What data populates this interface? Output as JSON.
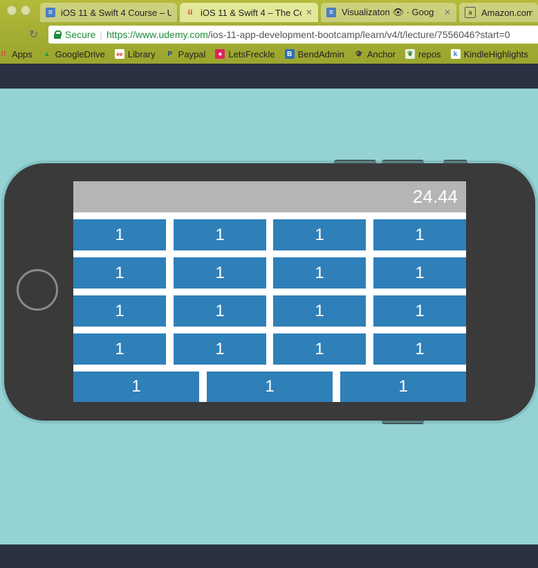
{
  "browser": {
    "tabs": [
      {
        "title": "iOS 11 & Swift 4 Course – U",
        "favicon": "doc-icon"
      },
      {
        "title": "iOS 11 & Swift 4 – The Co",
        "favicon": "udemy-icon"
      },
      {
        "title": "Visualizaton 👁 · Goog",
        "favicon": "doc-icon"
      },
      {
        "title": "Amazon.com: T",
        "favicon": "amazon-icon"
      }
    ],
    "security_label": "Secure",
    "url_host": "https://www.udemy.com",
    "url_path": "/ios-11-app-development-bootcamp/learn/v4/t/lecture/7556046?start=0",
    "bookmarks": [
      "Apps",
      "GoogleDrive",
      "Library",
      "Paypal",
      "LetsFreckle",
      "BendAdmin",
      "Anchor",
      "repos",
      "KindleHighlights"
    ]
  },
  "calculator": {
    "display": "24.44",
    "rows": [
      [
        "1",
        "1",
        "1",
        "1"
      ],
      [
        "1",
        "1",
        "1",
        "1"
      ],
      [
        "1",
        "1",
        "1",
        "1"
      ],
      [
        "1",
        "1",
        "1",
        "1"
      ],
      [
        "1",
        "1",
        "1"
      ]
    ]
  },
  "colors": {
    "page_background": "#94d2d4",
    "phone_body": "#3a3a3a",
    "key_blue": "#2f7fb9",
    "display_gray": "#b5b5b5",
    "chrome_theme": "#a8b035"
  }
}
